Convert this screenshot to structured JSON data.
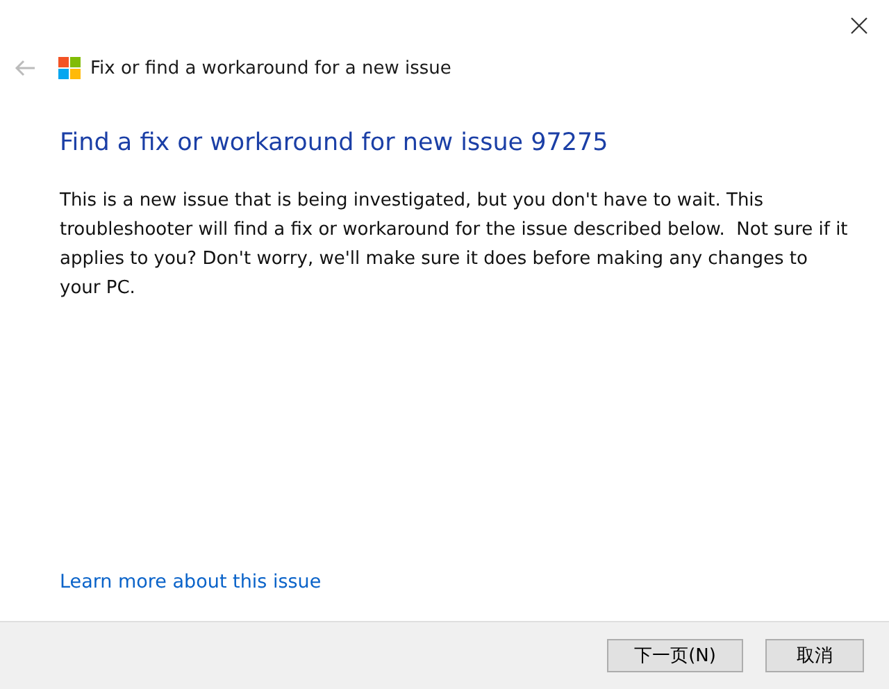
{
  "window": {
    "title": "Fix or find a workaround for a new issue"
  },
  "heading": "Find a fix or workaround for new issue 97275",
  "description": "This is a new issue that is being investigated, but you don't have to wait. This troubleshooter will find a fix or workaround for the issue described below.  Not sure if it applies to you? Don't worry, we'll make sure it does before making any changes to your PC.",
  "link": "Learn more about this issue",
  "buttons": [
    {
      "label": "下一页(N)"
    },
    {
      "label": "取消"
    }
  ]
}
